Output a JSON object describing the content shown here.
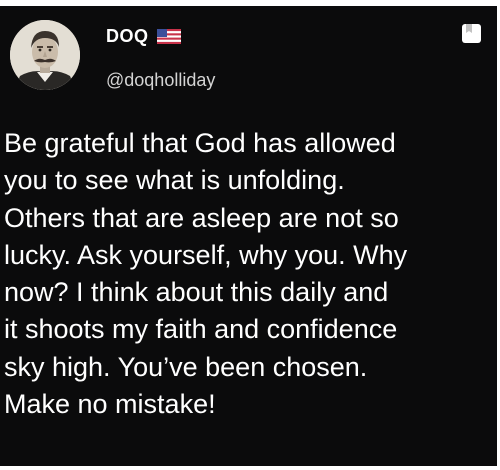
{
  "author": {
    "display_name": "DOQ",
    "flag_icon": "us-flag-icon",
    "handle": "@doqholliday"
  },
  "post": {
    "lines": [
      "Be grateful that God has allowed",
      "you to see what is unfolding.",
      "Others that are asleep are not so",
      "lucky. Ask yourself, why you. Why",
      "now? I think about this daily and",
      "it shoots my faith and confidence",
      "sky high. You’ve been chosen.",
      "Make no mistake!"
    ]
  },
  "icons": {
    "avatar": "avatar-icon",
    "bookmark": "bookmark-icon"
  },
  "colors": {
    "background": "#0b0b0c",
    "text": "#ffffff",
    "handle": "#d4d4d4"
  }
}
